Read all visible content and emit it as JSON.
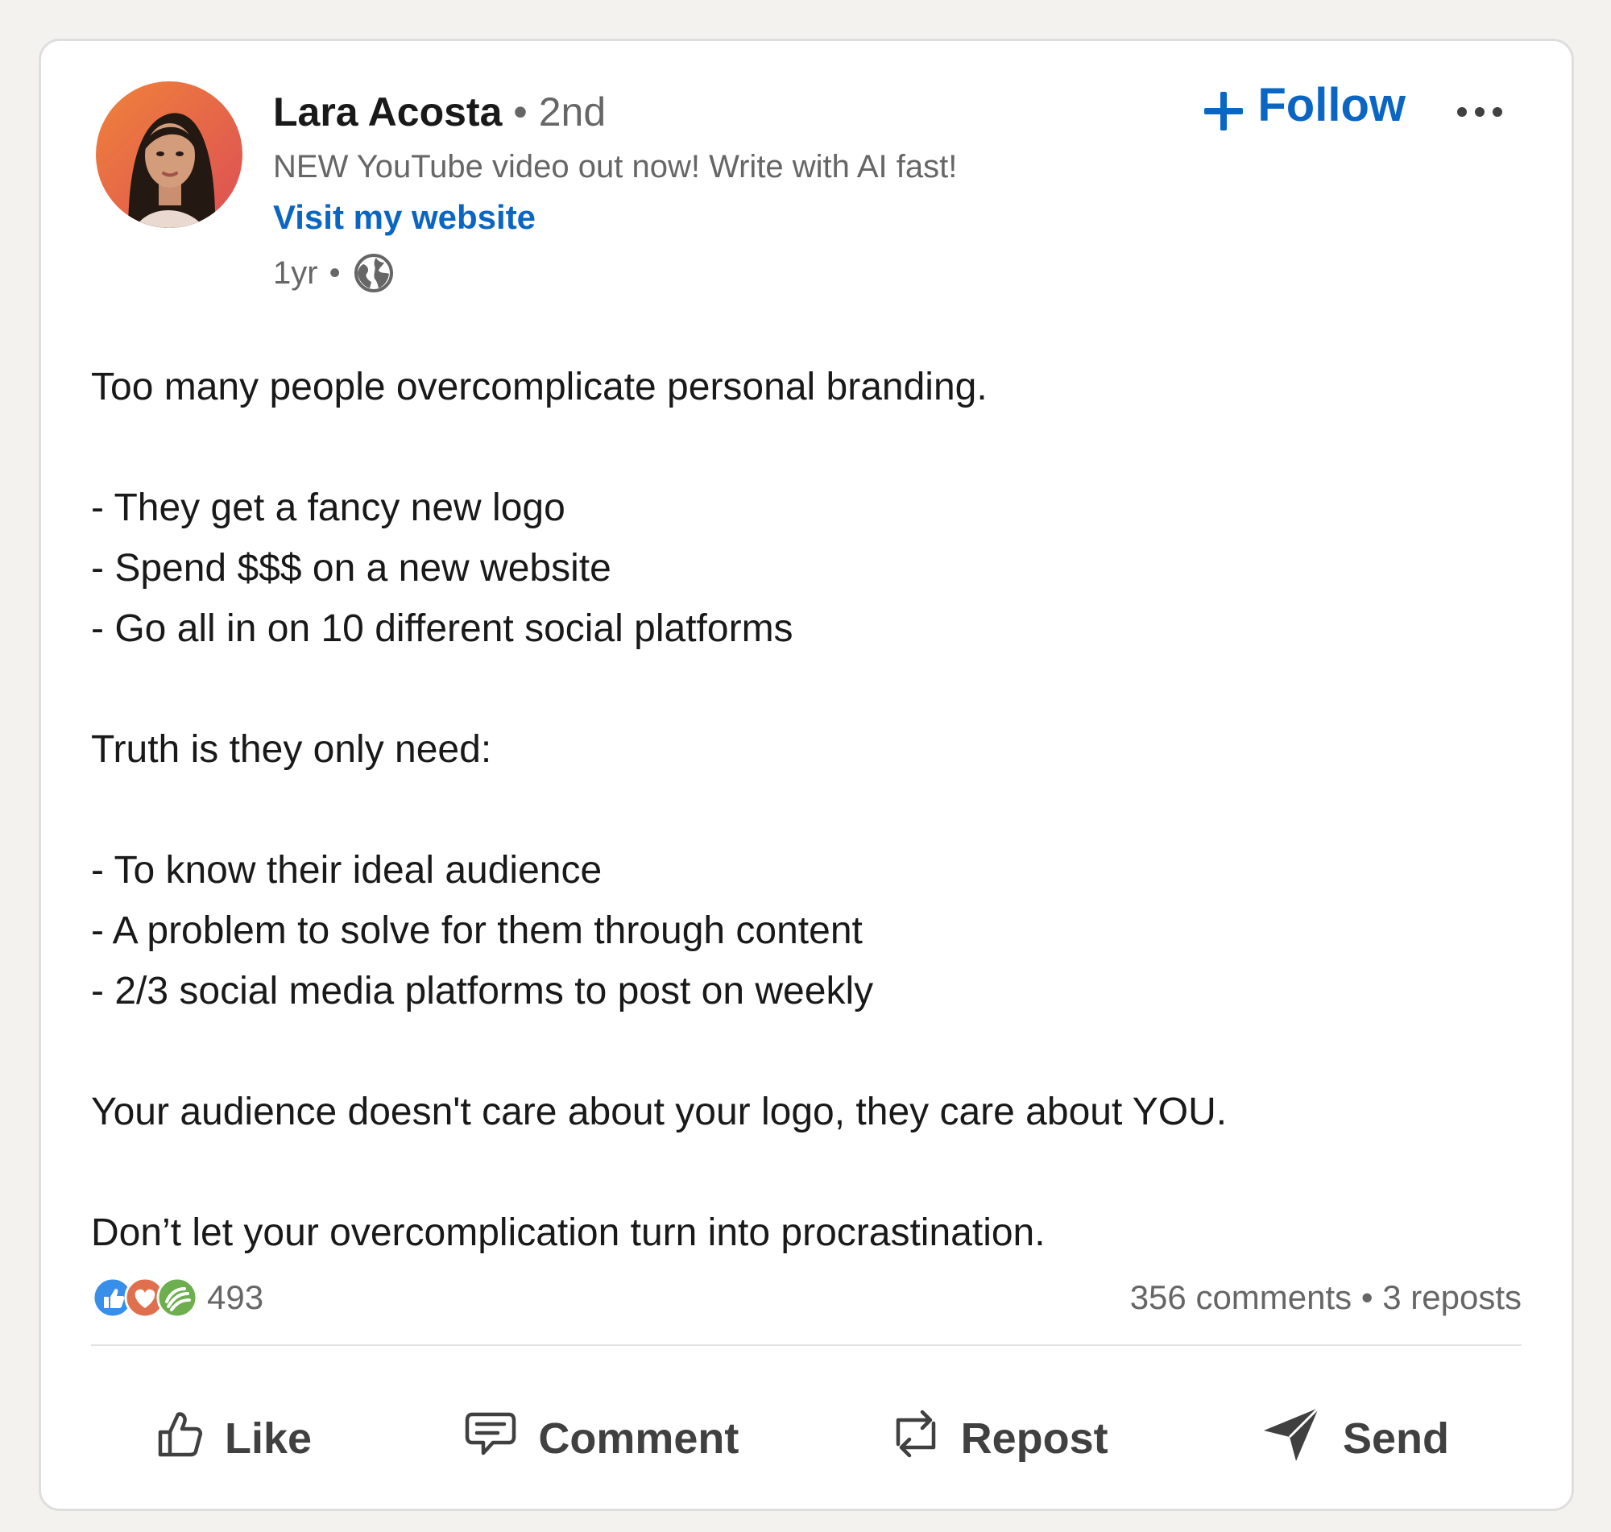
{
  "post": {
    "author": {
      "name": "Lara Acosta",
      "separator": "•",
      "degree": "2nd",
      "headline": "NEW YouTube video out now! Write with AI fast!",
      "link_label": "Visit my website",
      "age": "1yr",
      "meta_separator": "•",
      "visibility_icon": "globe-icon"
    },
    "follow_label": "Follow",
    "follow_icon": "plus-icon",
    "more_icon": "ellipsis-icon",
    "body_lines": [
      "Too many people overcomplicate personal branding.",
      "",
      "- They get a fancy new logo",
      "- Spend $$$ on a new website",
      "- Go all in on 10 different social platforms",
      "",
      "Truth is they only need:",
      "",
      "- To know their ideal audience",
      "- A problem to solve for them through content",
      "- 2/3 social media platforms to post on weekly",
      "",
      "Your audience doesn't care about your logo, they care about YOU.",
      "",
      "Don’t let your overcomplication turn into procrastination."
    ],
    "stats": {
      "reaction_icons": [
        "like-reaction-icon",
        "love-reaction-icon",
        "support-reaction-icon"
      ],
      "reactions_count": "493",
      "comments": "356 comments",
      "separator": "•",
      "reposts": "3 reposts"
    },
    "actions": {
      "like": "Like",
      "comment": "Comment",
      "repost": "Repost",
      "send": "Send"
    }
  },
  "colors": {
    "accent": "#0a66c2",
    "text": "#191919",
    "muted": "#666666",
    "action": "#404040",
    "like_reaction": "#378fe9",
    "love_reaction": "#df704d",
    "support_reaction": "#6dae4f"
  }
}
